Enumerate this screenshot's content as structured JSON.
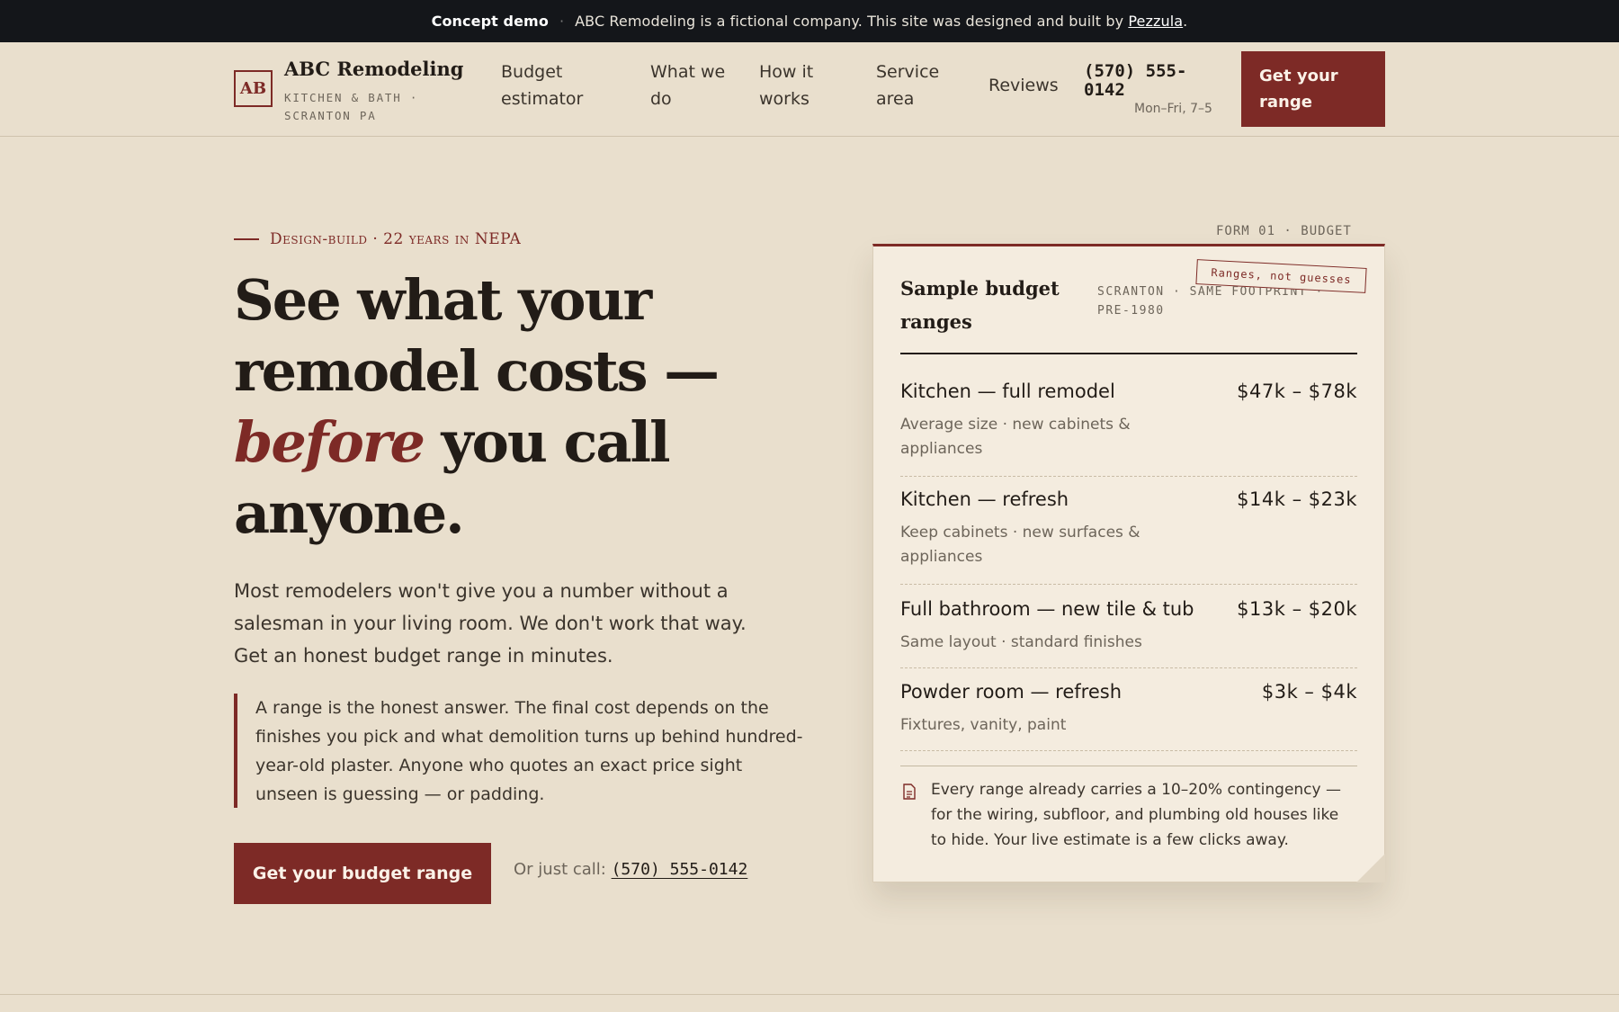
{
  "banner": {
    "label": "Concept demo",
    "separator": "·",
    "text": "ABC Remodeling is a fictional company. This site was designed and built by",
    "link": "Pezzula",
    "end": "."
  },
  "header": {
    "logo_mark": "AB",
    "brand": "ABC Remodeling",
    "tagline": "KITCHEN & BATH · SCRANTON PA",
    "nav": [
      "Budget estimator",
      "What we do",
      "How it works",
      "Service area",
      "Reviews"
    ],
    "phone": "(570) 555-0142",
    "hours": "Mon–Fri, 7–5",
    "cta": "Get your range"
  },
  "hero": {
    "eyebrow": "Design-build · 22 years in NEPA",
    "headline_1": "See what your remodel costs —",
    "headline_em": "before",
    "headline_2": "you call anyone.",
    "lede": "Most remodelers won't give you a number without a salesman in your living room. We don't work that way. Get an honest budget range in minutes.",
    "quote": "A range is the honest answer. The final cost depends on the finishes you pick and what demolition turns up behind hundred-year-old plaster. Anyone who quotes an exact price sight unseen is guessing — or padding.",
    "cta": "Get your budget range",
    "call_prefix": "Or just call:",
    "call_number": "(570) 555-0142"
  },
  "card": {
    "form_label": "FORM 01 · BUDGET",
    "title": "Sample budget ranges",
    "meta": "SCRANTON · SAME FOOTPRINT · PRE-1980",
    "stamp": "Ranges, not guesses",
    "rows": [
      {
        "name": "Kitchen — full remodel",
        "price": "$47k – $78k",
        "desc": "Average size · new cabinets & appliances"
      },
      {
        "name": "Kitchen — refresh",
        "price": "$14k – $23k",
        "desc": "Keep cabinets · new surfaces & appliances"
      },
      {
        "name": "Full bathroom — new tile & tub",
        "price": "$13k – $20k",
        "desc": "Same layout · standard finishes"
      },
      {
        "name": "Powder room — refresh",
        "price": "$3k – $4k",
        "desc": "Fixtures, vanity, paint"
      }
    ],
    "note": "Every range already carries a 10–20% contingency — for the wiring, subfloor, and plumbing old houses like to hide. Your live estimate is a few clicks away.",
    "note_icon": "document-icon"
  },
  "colors": {
    "accent": "#7d2a26",
    "background": "#e9dfcd",
    "card": "#f4ecdf",
    "banner": "#14161a"
  }
}
